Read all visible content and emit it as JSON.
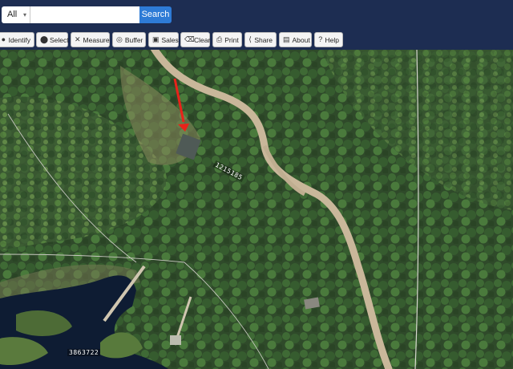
{
  "search": {
    "scope_value": "All",
    "scope_caret": "▾",
    "placeholder": "",
    "button_label": "Search"
  },
  "toolbar": {
    "tools": [
      {
        "label": "Identify",
        "icon": "●"
      },
      {
        "label": "Select",
        "icon": "⬤"
      },
      {
        "label": "Measure",
        "icon": "✕"
      },
      {
        "label": "Buffer",
        "icon": "◎"
      },
      {
        "label": "Sales",
        "icon": "▣"
      },
      {
        "label": "Clear",
        "icon": "⌫"
      },
      {
        "label": "Print",
        "icon": "⎙"
      },
      {
        "label": "Share",
        "icon": "⟨"
      },
      {
        "label": "About",
        "icon": "▤"
      },
      {
        "label": "Help",
        "icon": "?"
      }
    ]
  },
  "map": {
    "parcel_labels": [
      "1215185",
      "3863722"
    ],
    "colors": {
      "arrow": "#e8231a",
      "water": "#0e1c33",
      "road": "#c9b79a"
    }
  }
}
